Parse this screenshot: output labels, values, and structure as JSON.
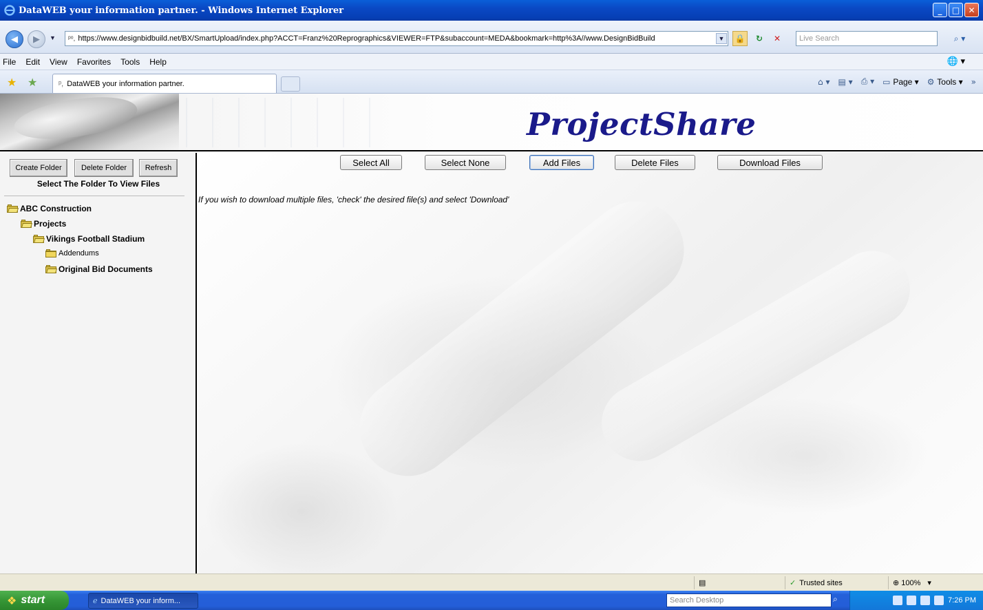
{
  "window": {
    "title": "DataWEB your information partner. - Windows Internet Explorer",
    "minimize": "_",
    "maximize": "□",
    "close": "✕"
  },
  "address": {
    "url": "https://www.designbidbuild.net/BX/SmartUpload/index.php?ACCT=Franz%20Reprographics&VIEWER=FTP&subaccount=MEDA&bookmark=http%3A//www.DesignBidBuild",
    "search_placeholder": "Live Search"
  },
  "menu": [
    "File",
    "Edit",
    "View",
    "Favorites",
    "Tools",
    "Help"
  ],
  "tab": {
    "label": "DataWEB your information partner."
  },
  "commands": {
    "page": "Page",
    "tools": "Tools"
  },
  "banner": {
    "logo": "ProjectShare"
  },
  "left_panel": {
    "buttons": [
      "Create Folder",
      "Delete Folder",
      "Refresh"
    ],
    "title": "Select The Folder To View Files",
    "tree": [
      {
        "label": "ABC Construction",
        "level": 0
      },
      {
        "label": "Projects",
        "level": 1
      },
      {
        "label": "Vikings Football Stadium",
        "level": 2
      },
      {
        "label": "Addendums",
        "level": 3
      },
      {
        "label": "Original Bid Documents",
        "level": 3
      }
    ]
  },
  "toolbar": {
    "select_all": "Select All",
    "select_none": "Select None",
    "add_files": "Add Files",
    "delete_files": "Delete Files",
    "download_files": "Download Files"
  },
  "hint": "If you wish to download multiple files, 'check' the desired file(s) and select 'Download'",
  "status": {
    "zone": "Trusted sites",
    "zoom": "100%"
  },
  "taskbar": {
    "start": "start",
    "item": "DataWEB your inform...",
    "search_placeholder": "Search Desktop",
    "clock": "7:26 PM"
  }
}
